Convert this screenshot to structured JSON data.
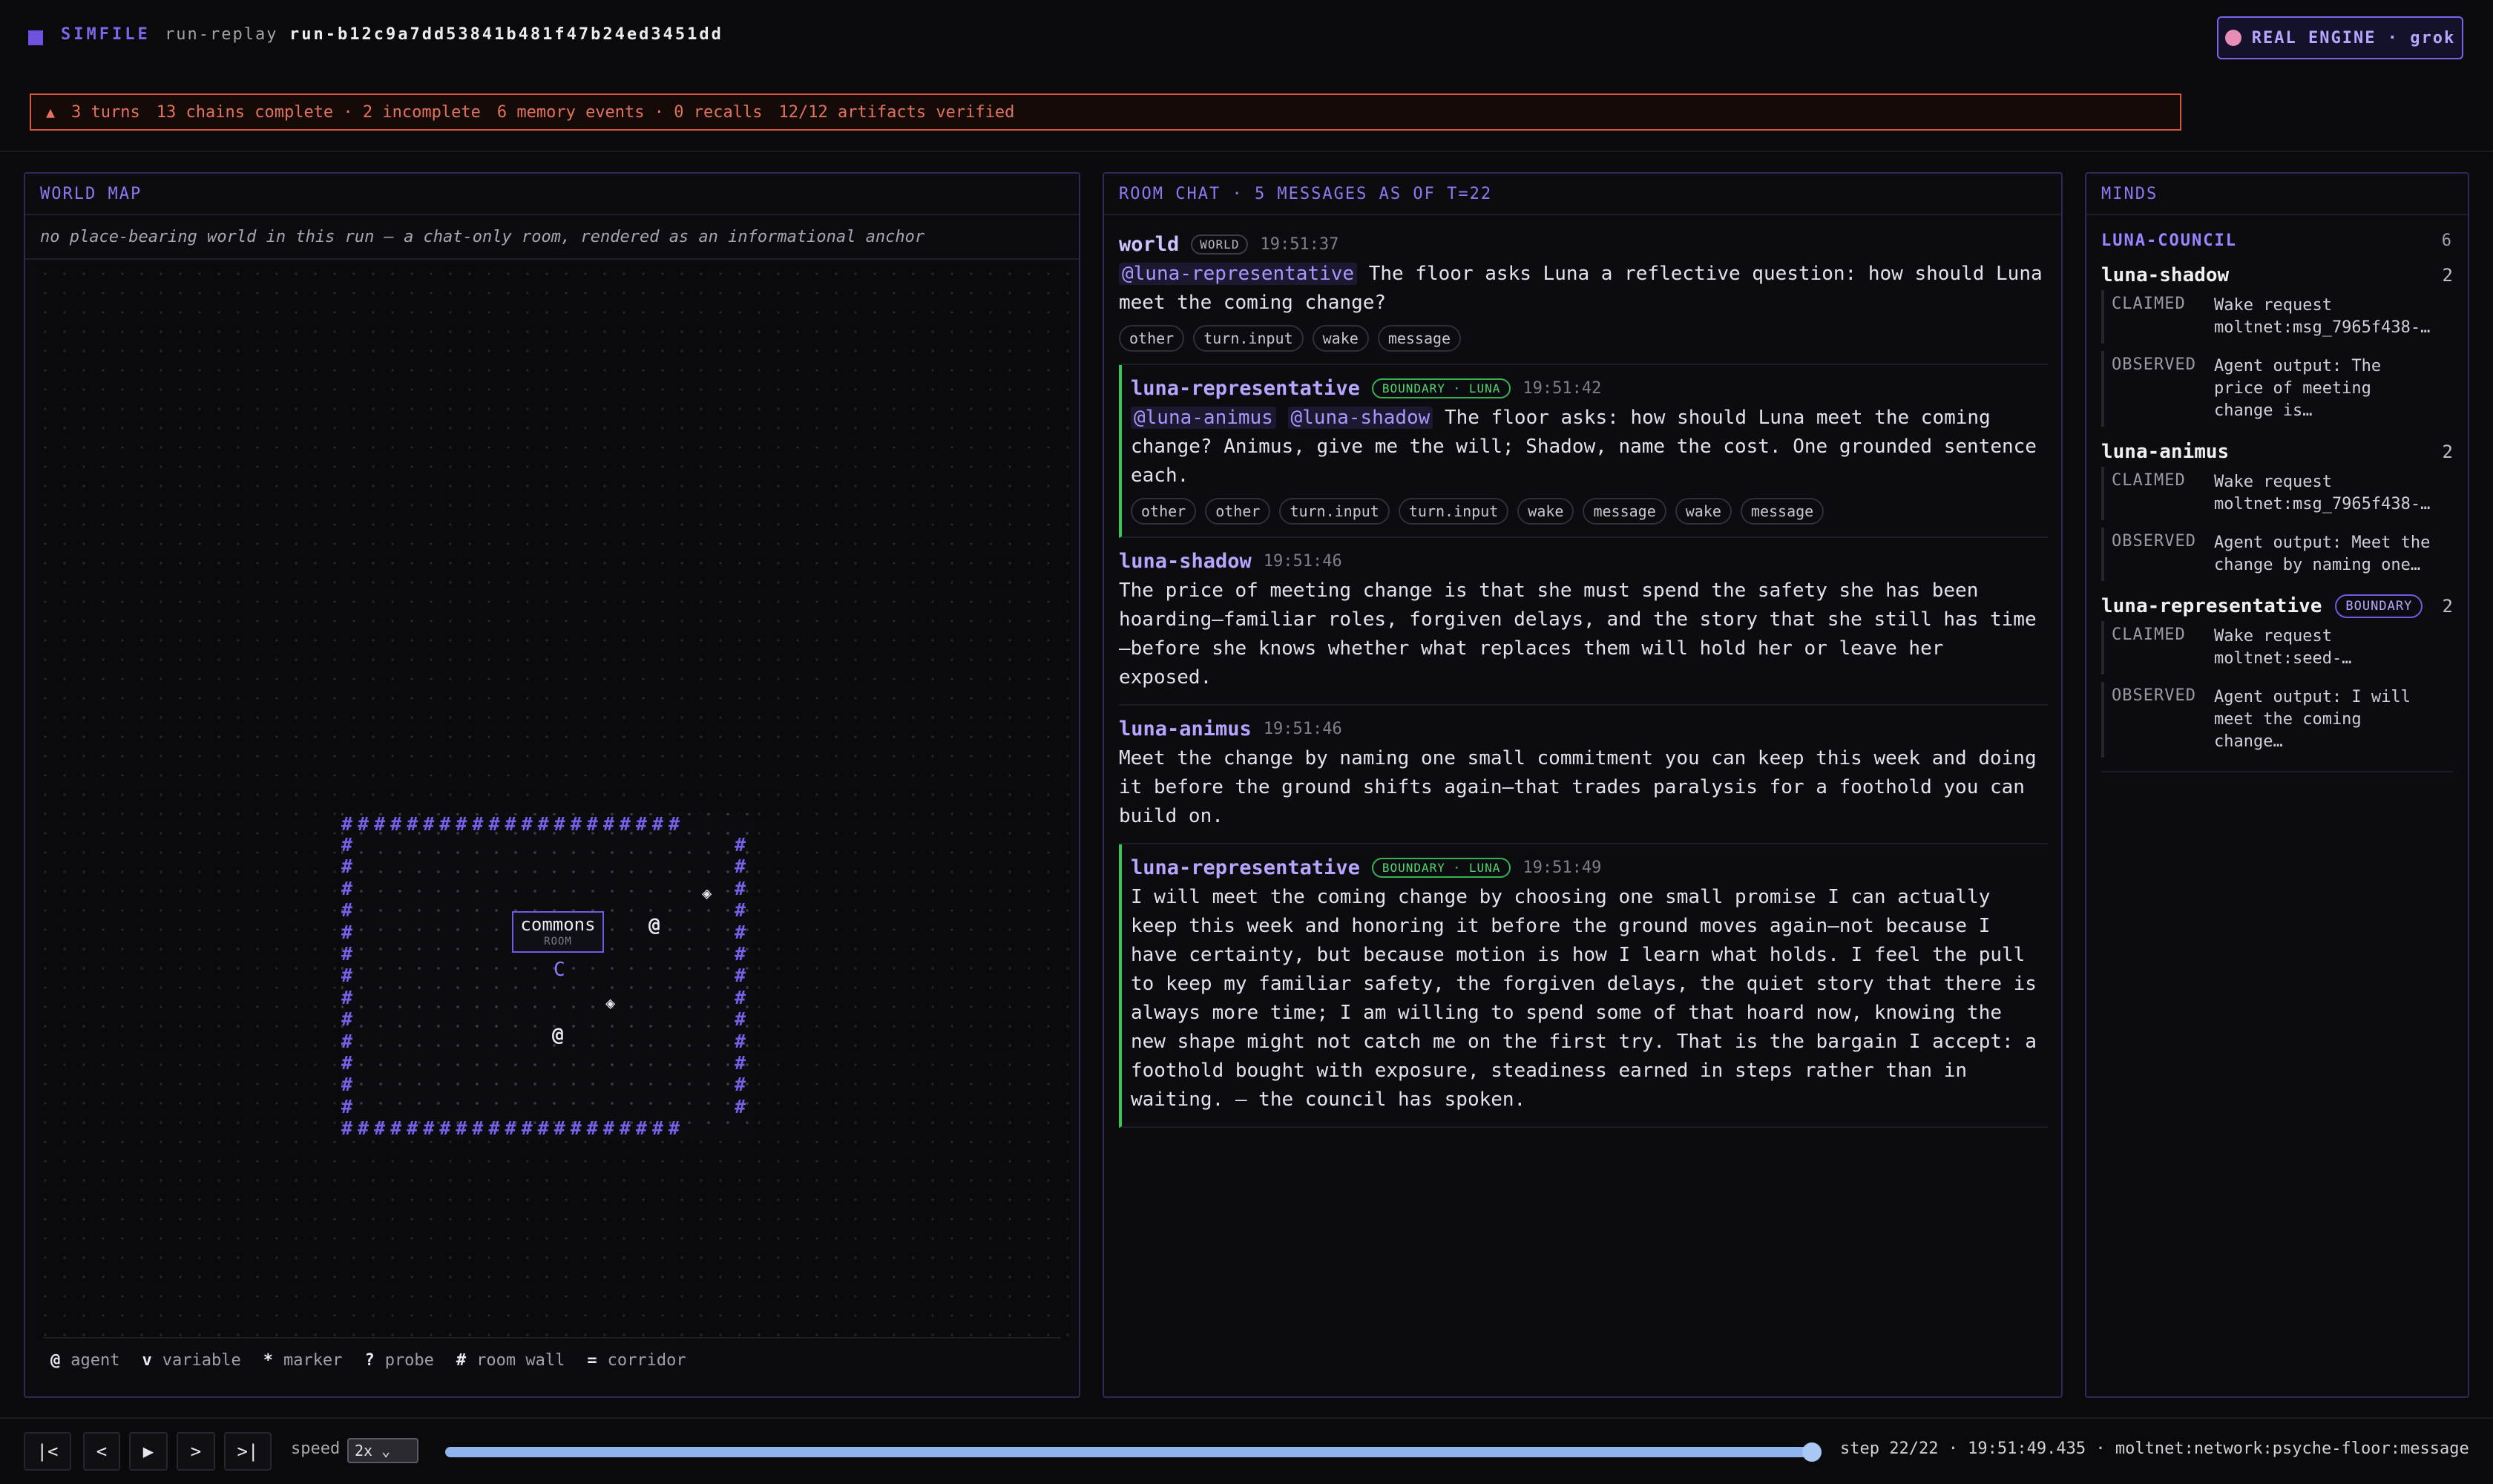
{
  "topbar": {
    "brand": "SIMFILE",
    "mode": "run-replay",
    "run_id": "run-b12c9a7dd53841b481f47b24ed3451dd",
    "engine_label": "REAL ENGINE · grok",
    "engine_icon": "brain-icon"
  },
  "alert": {
    "icon": "▲",
    "turns": "3 turns",
    "chains": "13 chains complete · 2 incomplete",
    "memory": "6 memory events · 0 recalls",
    "artifacts": "12/12 artifacts verified"
  },
  "world": {
    "title": "WORLD MAP",
    "note": "no place-bearing world in this run — a chat-only room, rendered as an informational anchor",
    "room_name": "commons",
    "room_sub": "ROOM",
    "glyphs": {
      "agent": "@",
      "marker": "◈",
      "cursor": "C",
      "wall": "#"
    },
    "legend": [
      {
        "sym": "@",
        "label": "agent"
      },
      {
        "sym": "v",
        "label": "variable"
      },
      {
        "sym": "*",
        "label": "marker"
      },
      {
        "sym": "?",
        "label": "probe"
      },
      {
        "sym": "#",
        "label": "room wall"
      },
      {
        "sym": "=",
        "label": "corridor"
      }
    ]
  },
  "chat": {
    "title": "ROOM CHAT · 5 MESSAGES AS OF T=22",
    "messages": [
      {
        "author": "world",
        "tag": "WORLD",
        "time": "19:51:37",
        "mentions": [
          "@luna-representative"
        ],
        "text": "The floor asks Luna a reflective question: how should Luna meet the coming change?",
        "chips": [
          "other",
          "turn.input",
          "wake",
          "message"
        ]
      },
      {
        "author": "luna-representative",
        "tag": "BOUNDARY · LUNA",
        "time": "19:51:42",
        "mentions": [
          "@luna-animus",
          "@luna-shadow"
        ],
        "text": "The floor asks: how should Luna meet the coming change? Animus, give me the will; Shadow, name the cost. One grounded sentence each.",
        "chips": [
          "other",
          "other",
          "turn.input",
          "turn.input",
          "wake",
          "message",
          "wake",
          "message"
        ]
      },
      {
        "author": "luna-shadow",
        "time": "19:51:46",
        "text": "The price of meeting change is that she must spend the safety she has been hoarding—familiar roles, forgiven delays, and the story that she still has time—before she knows whether what replaces them will hold her or leave her exposed."
      },
      {
        "author": "luna-animus",
        "time": "19:51:46",
        "text": "Meet the change by naming one small commitment you can keep this week and doing it before the ground shifts again—that trades paralysis for a foothold you can build on."
      },
      {
        "author": "luna-representative",
        "tag": "BOUNDARY · LUNA",
        "time": "19:51:49",
        "text": "I will meet the coming change by choosing one small promise I can actually keep this week and honoring it before the ground moves again—not because I have certainty, but because motion is how I learn what holds. I feel the pull to keep my familiar safety, the forgiven delays, the quiet story that there is always more time; I am willing to spend some of that hoard now, knowing the new shape might not catch me on the first try. That is the bargain I accept: a foothold bought with exposure, steadiness earned in steps rather than in waiting. — the council has spoken."
      }
    ]
  },
  "minds": {
    "title": "MINDS",
    "council_name": "LUNA-COUNCIL",
    "council_count": "6",
    "list": [
      {
        "name": "luna-shadow",
        "count": "2",
        "events": [
          {
            "kind": "CLAIMED",
            "text": "Wake request moltnet:msg_7965f438-…"
          },
          {
            "kind": "OBSERVED",
            "text": "Agent output: The price of meeting change is…"
          }
        ]
      },
      {
        "name": "luna-animus",
        "count": "2",
        "events": [
          {
            "kind": "CLAIMED",
            "text": "Wake request moltnet:msg_7965f438-…"
          },
          {
            "kind": "OBSERVED",
            "text": "Agent output: Meet the change by naming one…"
          }
        ]
      },
      {
        "name": "luna-representative",
        "badge": "BOUNDARY",
        "count": "2",
        "events": [
          {
            "kind": "CLAIMED",
            "text": "Wake request moltnet:seed-…"
          },
          {
            "kind": "OBSERVED",
            "text": "Agent output: I will meet the coming change…"
          }
        ]
      }
    ]
  },
  "playback": {
    "first": "|<",
    "prev": "<",
    "play": "▶",
    "next": ">",
    "last": ">|",
    "speed_label": "speed",
    "speed_value": "2x",
    "progress": 1.0,
    "status": "step 22/22 · 19:51:49.435 · moltnet:network:psyche-floor:message"
  }
}
